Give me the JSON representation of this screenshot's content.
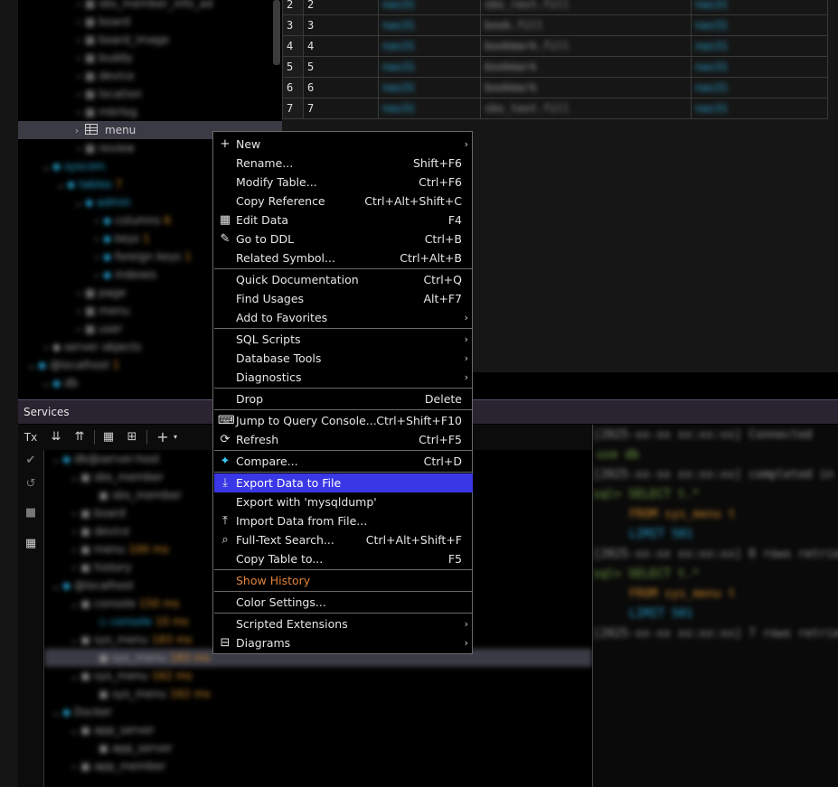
{
  "tree": {
    "selected_item": "menu"
  },
  "grid": {
    "rows": [
      {
        "row": "2",
        "id": "2"
      },
      {
        "row": "3",
        "id": "3"
      },
      {
        "row": "4",
        "id": "4"
      },
      {
        "row": "5",
        "id": "5"
      },
      {
        "row": "6",
        "id": "6"
      },
      {
        "row": "7",
        "id": "7"
      }
    ]
  },
  "services": {
    "title": "Services",
    "tx_label": "Tx"
  },
  "context_menu": {
    "items": [
      {
        "label": "New",
        "shortcut": "",
        "submenu": true,
        "icon": "plus-icon"
      },
      {
        "label": "Rename...",
        "shortcut": "Shift+F6"
      },
      {
        "label": "Modify Table...",
        "shortcut": "Ctrl+F6"
      },
      {
        "label": "Copy Reference",
        "shortcut": "Ctrl+Alt+Shift+C"
      },
      {
        "label": "Edit Data",
        "shortcut": "F4",
        "icon": "table-grid-icon"
      },
      {
        "label": "Go to DDL",
        "shortcut": "Ctrl+B",
        "icon": "pencil-icon"
      },
      {
        "label": "Related Symbol...",
        "shortcut": "Ctrl+Alt+B"
      },
      {
        "label": "Quick Documentation",
        "shortcut": "Ctrl+Q"
      },
      {
        "label": "Find Usages",
        "shortcut": "Alt+F7"
      },
      {
        "label": "Add to Favorites",
        "shortcut": "",
        "submenu": true
      },
      {
        "label": "SQL Scripts",
        "shortcut": "",
        "submenu": true
      },
      {
        "label": "Database Tools",
        "shortcut": "",
        "submenu": true
      },
      {
        "label": "Diagnostics",
        "shortcut": "",
        "submenu": true
      },
      {
        "label": "Drop",
        "shortcut": "Delete"
      },
      {
        "label": "Jump to Query Console...",
        "shortcut": "Ctrl+Shift+F10",
        "icon": "query-console-icon"
      },
      {
        "label": "Refresh",
        "shortcut": "Ctrl+F5",
        "icon": "refresh-icon"
      },
      {
        "label": "Compare...",
        "shortcut": "Ctrl+D",
        "icon": "compare-icon"
      },
      {
        "label": "Export Data to File",
        "shortcut": "",
        "icon": "export-icon",
        "highlighted": true
      },
      {
        "label": "Export with 'mysqldump'",
        "shortcut": ""
      },
      {
        "label": "Import Data from File...",
        "shortcut": "",
        "icon": "import-icon"
      },
      {
        "label": "Full-Text Search...",
        "shortcut": "Ctrl+Alt+Shift+F",
        "icon": "search-icon"
      },
      {
        "label": "Copy Table to...",
        "shortcut": "F5"
      },
      {
        "label": "Show History",
        "shortcut": ""
      },
      {
        "label": "Color Settings...",
        "shortcut": ""
      },
      {
        "label": "Scripted Extensions",
        "shortcut": "",
        "submenu": true
      },
      {
        "label": "Diagrams",
        "shortcut": "",
        "submenu": true,
        "icon": "diagram-icon"
      }
    ]
  }
}
